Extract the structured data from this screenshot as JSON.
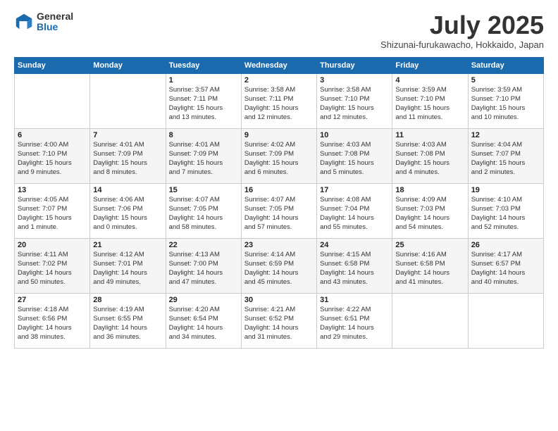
{
  "header": {
    "logo": {
      "general": "General",
      "blue": "Blue"
    },
    "title": "July 2025",
    "subtitle": "Shizunai-furukawacho, Hokkaido, Japan"
  },
  "weekdays": [
    "Sunday",
    "Monday",
    "Tuesday",
    "Wednesday",
    "Thursday",
    "Friday",
    "Saturday"
  ],
  "weeks": [
    [
      {
        "day": "",
        "info": ""
      },
      {
        "day": "",
        "info": ""
      },
      {
        "day": "1",
        "info": "Sunrise: 3:57 AM\nSunset: 7:11 PM\nDaylight: 15 hours\nand 13 minutes."
      },
      {
        "day": "2",
        "info": "Sunrise: 3:58 AM\nSunset: 7:11 PM\nDaylight: 15 hours\nand 12 minutes."
      },
      {
        "day": "3",
        "info": "Sunrise: 3:58 AM\nSunset: 7:10 PM\nDaylight: 15 hours\nand 12 minutes."
      },
      {
        "day": "4",
        "info": "Sunrise: 3:59 AM\nSunset: 7:10 PM\nDaylight: 15 hours\nand 11 minutes."
      },
      {
        "day": "5",
        "info": "Sunrise: 3:59 AM\nSunset: 7:10 PM\nDaylight: 15 hours\nand 10 minutes."
      }
    ],
    [
      {
        "day": "6",
        "info": "Sunrise: 4:00 AM\nSunset: 7:10 PM\nDaylight: 15 hours\nand 9 minutes."
      },
      {
        "day": "7",
        "info": "Sunrise: 4:01 AM\nSunset: 7:09 PM\nDaylight: 15 hours\nand 8 minutes."
      },
      {
        "day": "8",
        "info": "Sunrise: 4:01 AM\nSunset: 7:09 PM\nDaylight: 15 hours\nand 7 minutes."
      },
      {
        "day": "9",
        "info": "Sunrise: 4:02 AM\nSunset: 7:09 PM\nDaylight: 15 hours\nand 6 minutes."
      },
      {
        "day": "10",
        "info": "Sunrise: 4:03 AM\nSunset: 7:08 PM\nDaylight: 15 hours\nand 5 minutes."
      },
      {
        "day": "11",
        "info": "Sunrise: 4:03 AM\nSunset: 7:08 PM\nDaylight: 15 hours\nand 4 minutes."
      },
      {
        "day": "12",
        "info": "Sunrise: 4:04 AM\nSunset: 7:07 PM\nDaylight: 15 hours\nand 2 minutes."
      }
    ],
    [
      {
        "day": "13",
        "info": "Sunrise: 4:05 AM\nSunset: 7:07 PM\nDaylight: 15 hours\nand 1 minute."
      },
      {
        "day": "14",
        "info": "Sunrise: 4:06 AM\nSunset: 7:06 PM\nDaylight: 15 hours\nand 0 minutes."
      },
      {
        "day": "15",
        "info": "Sunrise: 4:07 AM\nSunset: 7:05 PM\nDaylight: 14 hours\nand 58 minutes."
      },
      {
        "day": "16",
        "info": "Sunrise: 4:07 AM\nSunset: 7:05 PM\nDaylight: 14 hours\nand 57 minutes."
      },
      {
        "day": "17",
        "info": "Sunrise: 4:08 AM\nSunset: 7:04 PM\nDaylight: 14 hours\nand 55 minutes."
      },
      {
        "day": "18",
        "info": "Sunrise: 4:09 AM\nSunset: 7:03 PM\nDaylight: 14 hours\nand 54 minutes."
      },
      {
        "day": "19",
        "info": "Sunrise: 4:10 AM\nSunset: 7:03 PM\nDaylight: 14 hours\nand 52 minutes."
      }
    ],
    [
      {
        "day": "20",
        "info": "Sunrise: 4:11 AM\nSunset: 7:02 PM\nDaylight: 14 hours\nand 50 minutes."
      },
      {
        "day": "21",
        "info": "Sunrise: 4:12 AM\nSunset: 7:01 PM\nDaylight: 14 hours\nand 49 minutes."
      },
      {
        "day": "22",
        "info": "Sunrise: 4:13 AM\nSunset: 7:00 PM\nDaylight: 14 hours\nand 47 minutes."
      },
      {
        "day": "23",
        "info": "Sunrise: 4:14 AM\nSunset: 6:59 PM\nDaylight: 14 hours\nand 45 minutes."
      },
      {
        "day": "24",
        "info": "Sunrise: 4:15 AM\nSunset: 6:58 PM\nDaylight: 14 hours\nand 43 minutes."
      },
      {
        "day": "25",
        "info": "Sunrise: 4:16 AM\nSunset: 6:58 PM\nDaylight: 14 hours\nand 41 minutes."
      },
      {
        "day": "26",
        "info": "Sunrise: 4:17 AM\nSunset: 6:57 PM\nDaylight: 14 hours\nand 40 minutes."
      }
    ],
    [
      {
        "day": "27",
        "info": "Sunrise: 4:18 AM\nSunset: 6:56 PM\nDaylight: 14 hours\nand 38 minutes."
      },
      {
        "day": "28",
        "info": "Sunrise: 4:19 AM\nSunset: 6:55 PM\nDaylight: 14 hours\nand 36 minutes."
      },
      {
        "day": "29",
        "info": "Sunrise: 4:20 AM\nSunset: 6:54 PM\nDaylight: 14 hours\nand 34 minutes."
      },
      {
        "day": "30",
        "info": "Sunrise: 4:21 AM\nSunset: 6:52 PM\nDaylight: 14 hours\nand 31 minutes."
      },
      {
        "day": "31",
        "info": "Sunrise: 4:22 AM\nSunset: 6:51 PM\nDaylight: 14 hours\nand 29 minutes."
      },
      {
        "day": "",
        "info": ""
      },
      {
        "day": "",
        "info": ""
      }
    ]
  ]
}
